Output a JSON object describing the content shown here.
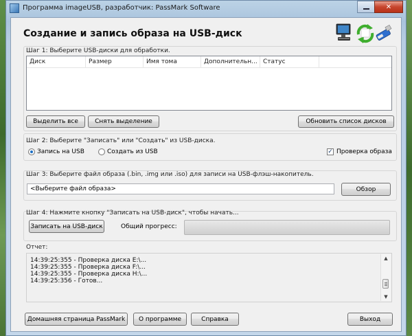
{
  "window": {
    "title": "Программа imageUSB, разработчик: PassMark Software",
    "close_glyph": "✕"
  },
  "header": {
    "title": "Создание и запись образа на USB-диск"
  },
  "step1": {
    "label": "Шаг 1: Выберите USB-диски для обработки.",
    "columns": [
      "Диск",
      "Размер",
      "Имя тома",
      "Дополнительн...",
      "Статус"
    ],
    "select_all": "Выделить все",
    "deselect": "Снять выделение",
    "refresh": "Обновить список дисков"
  },
  "step2": {
    "label": "Шаг 2: Выберите \"Записать\" или \"Создать\" из USB-диска.",
    "write_option": "Запись на USB",
    "create_option": "Создать из USB",
    "verify_label": "Проверка образа",
    "verify_checked": true,
    "selected": "write"
  },
  "step3": {
    "label": "Шаг 3: Выберите файл образа (.bin, .img или .iso) для записи на USB-флэш-накопитель.",
    "file_value": "<Выберите файл образа>",
    "browse": "Обзор"
  },
  "step4": {
    "label": "Шаг 4: Нажмите кнопку \"Записать на USB-диск\", чтобы начать...",
    "write_button": "Записать на USB-диск",
    "progress_label": "Общий прогресс:",
    "progress": 0
  },
  "report": {
    "label": "Отчет:",
    "lines": [
      "14:39:25:355 - Проверка диска E:\\...",
      "14:39:25:355 - Проверка диска F:\\...",
      "14:39:25:355 - Проверка диска H:\\...",
      "14:39:25:356 - Готов..."
    ]
  },
  "footer": {
    "home": "Домашняя страница PassMark",
    "about": "О программе",
    "help": "Справка",
    "exit": "Выход"
  },
  "icons": [
    "app-icon",
    "computer-icon",
    "refresh-arrows-icon",
    "usb-drive-icon"
  ]
}
